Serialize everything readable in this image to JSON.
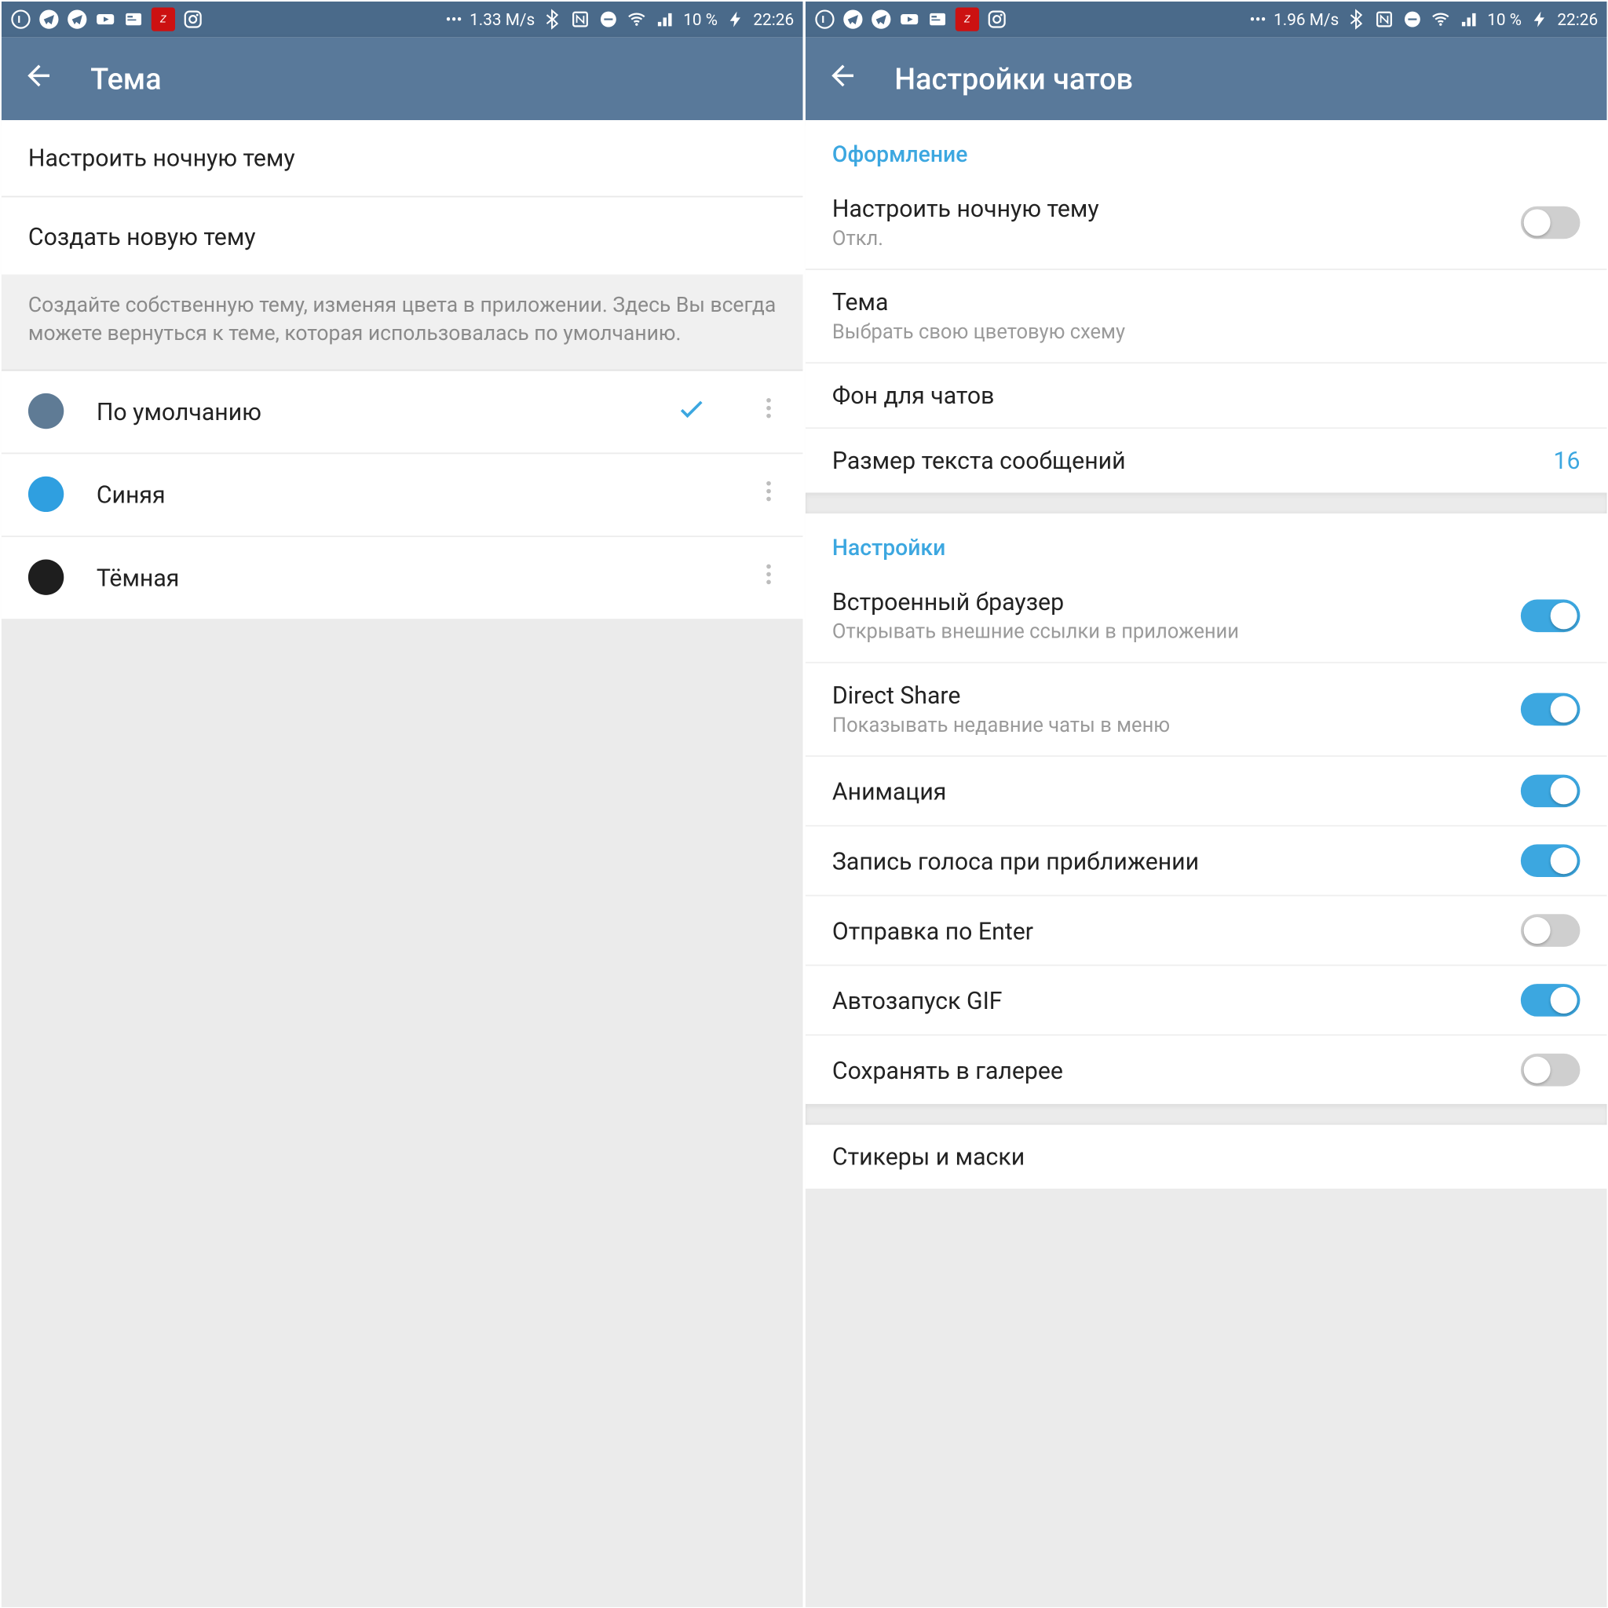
{
  "left": {
    "status": {
      "speed": "1.33 M/s",
      "battery": "10 %",
      "time": "22:26"
    },
    "appbar": {
      "title": "Тема"
    },
    "rows": {
      "configure_night": "Настроить ночную тему",
      "create_theme": "Создать новую тему"
    },
    "hint": "Создайте собственную тему, изменяя цвета в приложении. Здесь Вы всегда можете вернуться к теме, которая использовалась по умолчанию.",
    "themes": [
      {
        "name": "По умолчанию",
        "color": "#5f7b95",
        "selected": true
      },
      {
        "name": "Синяя",
        "color": "#2f9fe0",
        "selected": false
      },
      {
        "name": "Тёмная",
        "color": "#1e1e1e",
        "selected": false
      }
    ]
  },
  "right": {
    "status": {
      "speed": "1.96 M/s",
      "battery": "10 %",
      "time": "22:26"
    },
    "appbar": {
      "title": "Настройки чатов"
    },
    "section_design": "Оформление",
    "design": {
      "night_theme": {
        "primary": "Настроить ночную тему",
        "secondary": "Откл.",
        "on": false
      },
      "theme": {
        "primary": "Тема",
        "secondary": "Выбрать свою цветовую схему"
      },
      "background": {
        "primary": "Фон для чатов"
      },
      "text_size": {
        "primary": "Размер текста сообщений",
        "value": "16"
      }
    },
    "section_settings": "Настройки",
    "settings": {
      "browser": {
        "primary": "Встроенный браузер",
        "secondary": "Открывать внешние ссылки в приложении",
        "on": true
      },
      "direct_share": {
        "primary": "Direct Share",
        "secondary": "Показывать недавние чаты в меню",
        "on": true
      },
      "animation": {
        "primary": "Анимация",
        "on": true
      },
      "voice_proximity": {
        "primary": "Запись голоса при приближении",
        "on": true
      },
      "send_enter": {
        "primary": "Отправка по Enter",
        "on": false
      },
      "autoplay_gif": {
        "primary": "Автозапуск GIF",
        "on": true
      },
      "save_gallery": {
        "primary": "Сохранять в галерее",
        "on": false
      }
    },
    "stickers": "Стикеры и маски"
  }
}
